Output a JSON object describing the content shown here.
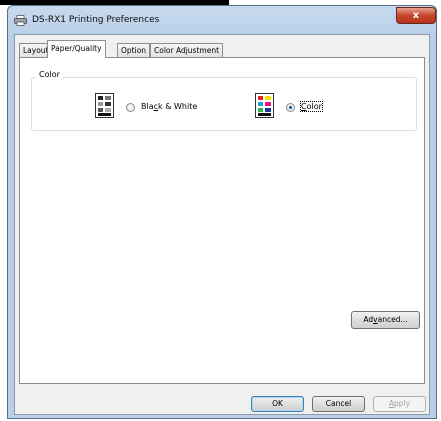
{
  "window": {
    "title": "DS-RX1 Printing Preferences",
    "close_label": "x",
    "accent_color": "#c6452b"
  },
  "tabs": [
    {
      "label": "Layout",
      "active": false
    },
    {
      "label": "Paper/Quality",
      "active": true
    },
    {
      "label": "Option",
      "active": false
    },
    {
      "label": "Color Adjustment",
      "active": false
    }
  ],
  "color_group": {
    "label": "Color",
    "options": [
      {
        "pre": "Bla",
        "mnemonic": "c",
        "post": "k & White",
        "selected": false,
        "icon": "black-white-print-icon"
      },
      {
        "pre": "",
        "mnemonic": "C",
        "post": "olor",
        "selected": true,
        "icon": "color-print-icon"
      }
    ]
  },
  "advanced_button": {
    "pre": "Ad",
    "mnemonic": "v",
    "post": "anced..."
  },
  "footer": {
    "ok": "OK",
    "cancel": "Cancel",
    "apply_mnemonic": "A",
    "apply_rest": "pply"
  }
}
